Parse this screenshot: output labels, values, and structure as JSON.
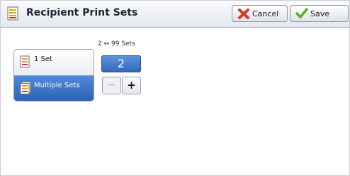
{
  "header": {
    "title": "Recipient Print Sets",
    "cancel_label": "Cancel",
    "save_label": "Save"
  },
  "options": [
    {
      "label": "1 Set",
      "selected": false
    },
    {
      "label": "Multiple Sets",
      "selected": true
    }
  ],
  "sets": {
    "range_label": "2 ↔ 99 Sets",
    "value": "2",
    "decrement_label": "−",
    "increment_label": "+",
    "decrement_enabled": false
  },
  "colors": {
    "selected": "#3a73c8",
    "cancel_icon": "#d63a2a",
    "save_icon": "#5fae2f",
    "doc_icon_accent": "#e8a21a"
  }
}
